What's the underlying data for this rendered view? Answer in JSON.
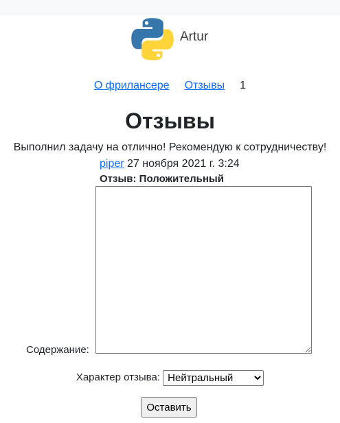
{
  "brand": {
    "name": "Artur",
    "logo_icon": "python-logo-icon",
    "logo_colors": {
      "blue": "#3776ab",
      "yellow": "#ffd43b"
    }
  },
  "nav": {
    "about_label": "О фрилансере",
    "reviews_label": "Отзывы",
    "page_number": "1"
  },
  "main": {
    "title": "Отзывы",
    "review": {
      "text": "Выполнил задачу на отлично! Рекомендую к сотрудничеству!",
      "author": "piper",
      "date": "27 ноября 2021 г. 3:24",
      "kind_text": "Отзыв: Положительный"
    }
  },
  "form": {
    "content_label": "Содержание:",
    "content_value": "",
    "kind_label": "Характер отзыва:",
    "kind_selected": "Нейтральный",
    "submit_label": "Оставить"
  },
  "colors": {
    "link": "#0d6efd",
    "topbar": "#f8f9fa",
    "text": "#212529"
  }
}
